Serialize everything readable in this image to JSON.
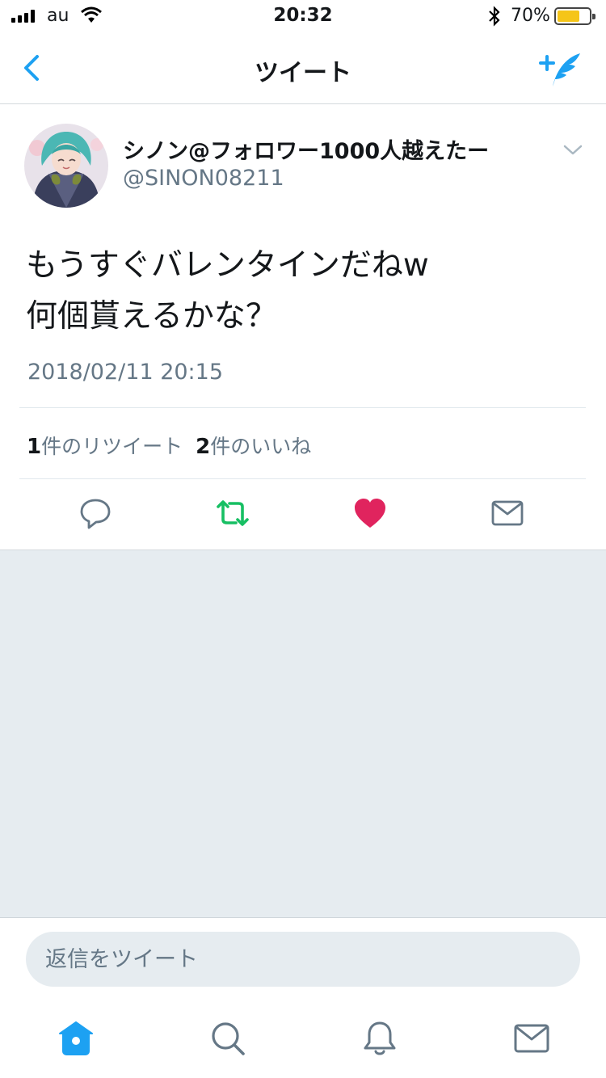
{
  "status_bar": {
    "carrier": "au",
    "time": "20:32",
    "battery_percent": "70%",
    "battery_level": 0.7,
    "battery_color": "#f5c518",
    "icons": [
      "signal-icon",
      "wifi-icon",
      "bluetooth-icon",
      "battery-icon"
    ]
  },
  "nav": {
    "title": "ツイート",
    "back_icon": "chevron-left-icon",
    "compose_icon": "compose-tweet-icon"
  },
  "tweet": {
    "author_name": "シノン@フォロワー1000人越えたー",
    "handle": "@SINON08211",
    "text": "もうすぐバレンタインだねw\n何個貰えるかな？",
    "timestamp": "2018/02/11 20:15",
    "retweet_count": "1",
    "retweet_label": "件のリツイート",
    "like_count": "2",
    "like_label": "件のいいね",
    "liked": true
  },
  "actions": [
    "reply-icon",
    "retweet-icon",
    "like-icon",
    "direct-message-icon"
  ],
  "reply": {
    "placeholder": "返信をツイート"
  },
  "tabbar": [
    "home-icon",
    "search-icon",
    "notifications-icon",
    "messages-icon"
  ],
  "colors": {
    "accent": "#1da1f2",
    "retweet": "#17bf63",
    "like": "#e0245e",
    "muted": "#657786",
    "background": "#e6ecf0"
  }
}
